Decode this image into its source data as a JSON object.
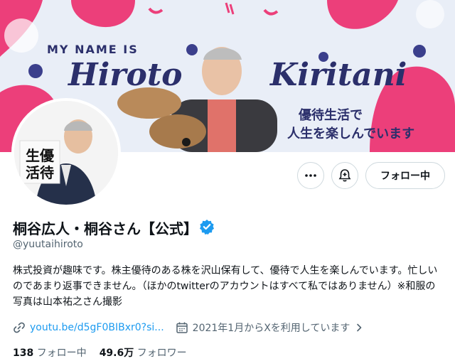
{
  "banner": {
    "my_name_is": "MY NAME IS",
    "first_name": "Hiroto",
    "last_name": "Kiritani",
    "tagline_1": "優待生活で",
    "tagline_2": "人生を楽しんでいます"
  },
  "avatar": {
    "calligraphy": "生優 活待"
  },
  "actions": {
    "more_icon": "more-horizontal-icon",
    "notify_icon": "bell-plus-icon",
    "follow_label": "フォロー中"
  },
  "profile": {
    "display_name": "桐谷広人・桐谷さん【公式】",
    "verified_icon": "verified-badge-icon",
    "handle": "@yuutaihiroto",
    "bio": "株式投資が趣味です。株主優待のある株を沢山保有して、優待で人生を楽しんでいます。忙しいのであまり返事できません。（ほかのtwitterのアカウントはすべて私ではありません）※和服の写真は山本祐之さん撮影",
    "link": "youtu.be/d5gF0BIBxr0?si...",
    "joined": "2021年1月からXを利用しています"
  },
  "stats": {
    "following_count": "138",
    "following_label": "フォロー中",
    "followers_count": "49.6万",
    "followers_label": "フォロワー"
  },
  "colors": {
    "accent_blue": "#1d9bf0",
    "banner_navy": "#2b2f6b",
    "banner_pink": "#ec3f7a",
    "muted_text": "#536471"
  }
}
